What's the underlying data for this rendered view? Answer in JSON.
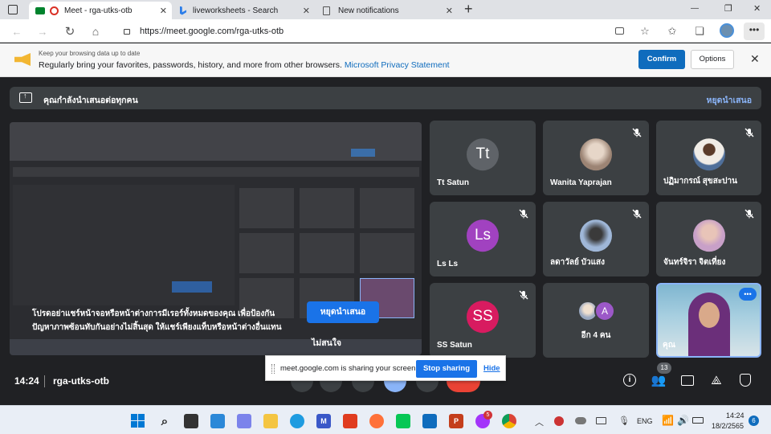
{
  "browser": {
    "tabs": [
      {
        "label": "Meet - rga-utks-otb",
        "active": true
      },
      {
        "label": "liveworksheets - Search",
        "active": false
      },
      {
        "label": "New notifications",
        "active": false
      }
    ],
    "new_tab": "+",
    "url": "https://meet.google.com/rga-utks-otb",
    "window_controls": {
      "minimize": "—",
      "restore": "❐",
      "close": "✕"
    }
  },
  "infobar": {
    "line1": "Keep your browsing data up to date",
    "line2": "Regularly bring your favorites, passwords, history, and more from other browsers.",
    "link": "Microsoft Privacy Statement",
    "confirm": "Confirm",
    "options": "Options"
  },
  "meet": {
    "presenting_text": "คุณกำลังนำเสนอต่อทุกคน",
    "stop_presenting_link": "หยุดนำเสนอ",
    "warning_text": "โปรดอย่าแชร์หน้าจอหรือหน้าต่างการมีเรอร์ทั้งหมดของคุณ เพื่อป้องกันปัญหาภาพซ้อนทับกันอย่างไม่สิ้นสุด ให้แชร์เพียงแท็บหรือหน้าต่างอื่นแทน",
    "stop_presenting_button": "หยุดนำเสนอ",
    "ignore_button": "ไม่สนใจ",
    "participants": [
      {
        "name": "Tt Satun",
        "initials": "Tt",
        "color": "#5f6368",
        "photo": false,
        "muted": false
      },
      {
        "name": "Wanita Yaprajan",
        "initials": "",
        "color": "#b0a090",
        "photo": true,
        "muted": true
      },
      {
        "name": "ปฏิมากรณ์ สุขสะปาน",
        "initials": "",
        "color": "#c9c2b8",
        "photo": true,
        "muted": true
      },
      {
        "name": "Ls Ls",
        "initials": "Ls",
        "color": "#a142c0",
        "photo": false,
        "muted": true
      },
      {
        "name": "ลดาวัลย์ บัวแสง",
        "initials": "",
        "color": "#8aa0c0",
        "photo": true,
        "muted": true
      },
      {
        "name": "จันทร์จิรา จิตเที่ยง",
        "initials": "",
        "color": "#d8c0d0",
        "photo": true,
        "muted": true
      },
      {
        "name": "SS Satun",
        "initials": "SS",
        "color": "#d81b60",
        "photo": false,
        "muted": true
      }
    ],
    "others_tile": {
      "label": "อีก 4 คน",
      "avatar_initial": "A",
      "avatar_color": "#9c58c8"
    },
    "self_tile": {
      "name": "คุณ",
      "menu": "•••"
    },
    "time": "14:24",
    "meeting_code": "rga-utks-otb",
    "participant_count": "13"
  },
  "share_bar": {
    "text": "meet.google.com is sharing your screen.",
    "stop": "Stop sharing",
    "hide": "Hide"
  },
  "taskbar": {
    "lang": "ENG",
    "time": "14:24",
    "date": "18/2/2565",
    "notification_count": "6",
    "messenger_badge": "5"
  },
  "colors": {
    "accent": "#1a73e8",
    "meet_bg": "#202124",
    "tile": "#3c4043",
    "link": "#8ab4f8"
  }
}
